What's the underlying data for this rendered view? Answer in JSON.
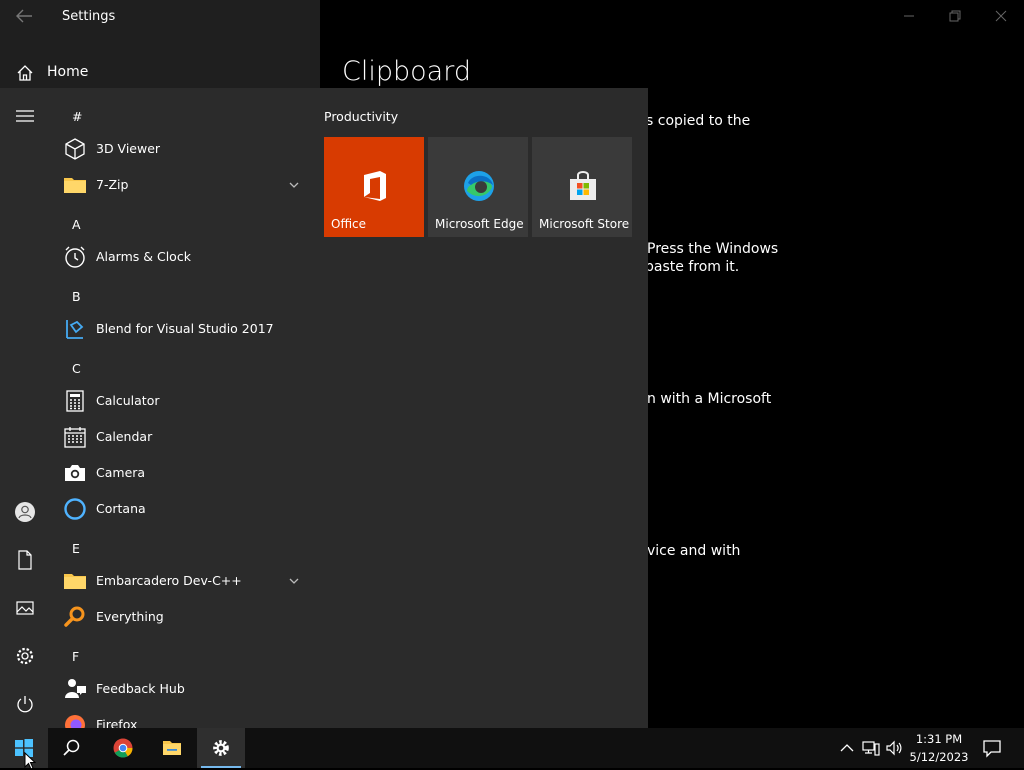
{
  "window": {
    "title": "Settings",
    "page_title": "Clipboard",
    "body_lines": [
      "s copied to the",
      "Press the Windows",
      "paste from it.",
      "n with a Microsoft",
      "vice and with"
    ]
  },
  "start": {
    "home_label": "Home",
    "apps": [
      {
        "type": "letter",
        "text": "#"
      },
      {
        "type": "app",
        "label": "3D Viewer",
        "icon": "cube-icon"
      },
      {
        "type": "app",
        "label": "7-Zip",
        "icon": "folder-icon",
        "expand": true
      },
      {
        "type": "letter",
        "text": "A"
      },
      {
        "type": "app",
        "label": "Alarms & Clock",
        "icon": "clock-icon"
      },
      {
        "type": "letter",
        "text": "B"
      },
      {
        "type": "app",
        "label": "Blend for Visual Studio 2017",
        "icon": "blend-icon"
      },
      {
        "type": "letter",
        "text": "C"
      },
      {
        "type": "app",
        "label": "Calculator",
        "icon": "calculator-icon"
      },
      {
        "type": "app",
        "label": "Calendar",
        "icon": "calendar-icon"
      },
      {
        "type": "app",
        "label": "Camera",
        "icon": "camera-icon"
      },
      {
        "type": "app",
        "label": "Cortana",
        "icon": "cortana-icon"
      },
      {
        "type": "letter",
        "text": "E"
      },
      {
        "type": "app",
        "label": "Embarcadero Dev-C++",
        "icon": "folder-icon",
        "expand": true
      },
      {
        "type": "app",
        "label": "Everything",
        "icon": "magnifier-icon"
      },
      {
        "type": "letter",
        "text": "F"
      },
      {
        "type": "app",
        "label": "Feedback Hub",
        "icon": "feedback-icon"
      },
      {
        "type": "app",
        "label": "Firefox",
        "icon": "firefox-icon"
      }
    ],
    "group_title": "Productivity",
    "tiles": [
      {
        "label": "Office",
        "color": "#d83b01",
        "icon": "office-icon"
      },
      {
        "label": "Microsoft Edge",
        "color": "#3a3a3a",
        "icon": "edge-icon"
      },
      {
        "label": "Microsoft Store",
        "color": "#3a3a3a",
        "icon": "store-icon"
      }
    ]
  },
  "taskbar": {
    "time": "1:31 PM",
    "date": "5/12/2023"
  }
}
